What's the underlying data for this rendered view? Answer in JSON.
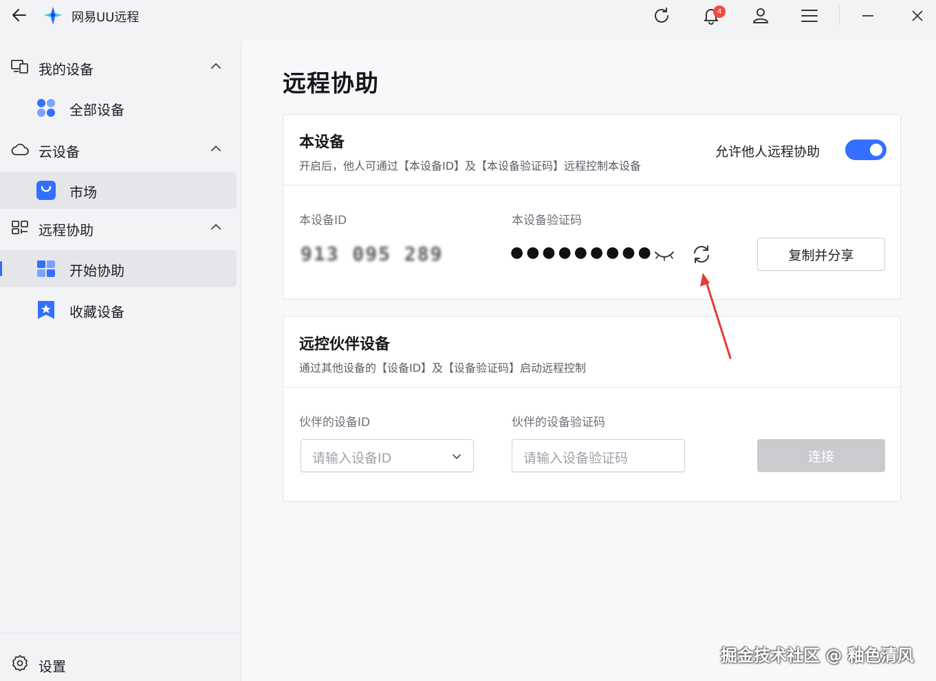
{
  "app": {
    "title": "网易UU远程"
  },
  "titlebar": {
    "notification_count": "4"
  },
  "sidebar": {
    "groups": [
      {
        "label": "我的设备",
        "items": [
          {
            "label": "全部设备"
          }
        ]
      },
      {
        "label": "云设备",
        "items": [
          {
            "label": "市场"
          }
        ]
      },
      {
        "label": "远程协助",
        "items": [
          {
            "label": "开始协助"
          },
          {
            "label": "收藏设备"
          }
        ]
      }
    ],
    "settings_label": "设置"
  },
  "main": {
    "page_title": "远程协助",
    "this_device": {
      "title": "本设备",
      "description": "开启后，他人可通过【本设备ID】及【本设备验证码】远程控制本设备",
      "toggle_label": "允许他人远程协助",
      "toggle_on": true,
      "id_label": "本设备ID",
      "id_value": "913 095 289",
      "code_label": "本设备验证码",
      "code_masked": "●●●●●●●●●",
      "copy_share_label": "复制并分享"
    },
    "partner": {
      "title": "远控伙伴设备",
      "description": "通过其他设备的【设备ID】及【设备验证码】启动远程控制",
      "id_label": "伙伴的设备ID",
      "id_placeholder": "请输入设备ID",
      "code_label": "伙伴的设备验证码",
      "code_placeholder": "请输入设备验证码",
      "connect_label": "连接"
    }
  },
  "watermark": "掘金技术社区 @ 釉色清风",
  "colors": {
    "accent": "#3370ff",
    "badge": "#f04a3e",
    "annotation": "#e53935"
  }
}
